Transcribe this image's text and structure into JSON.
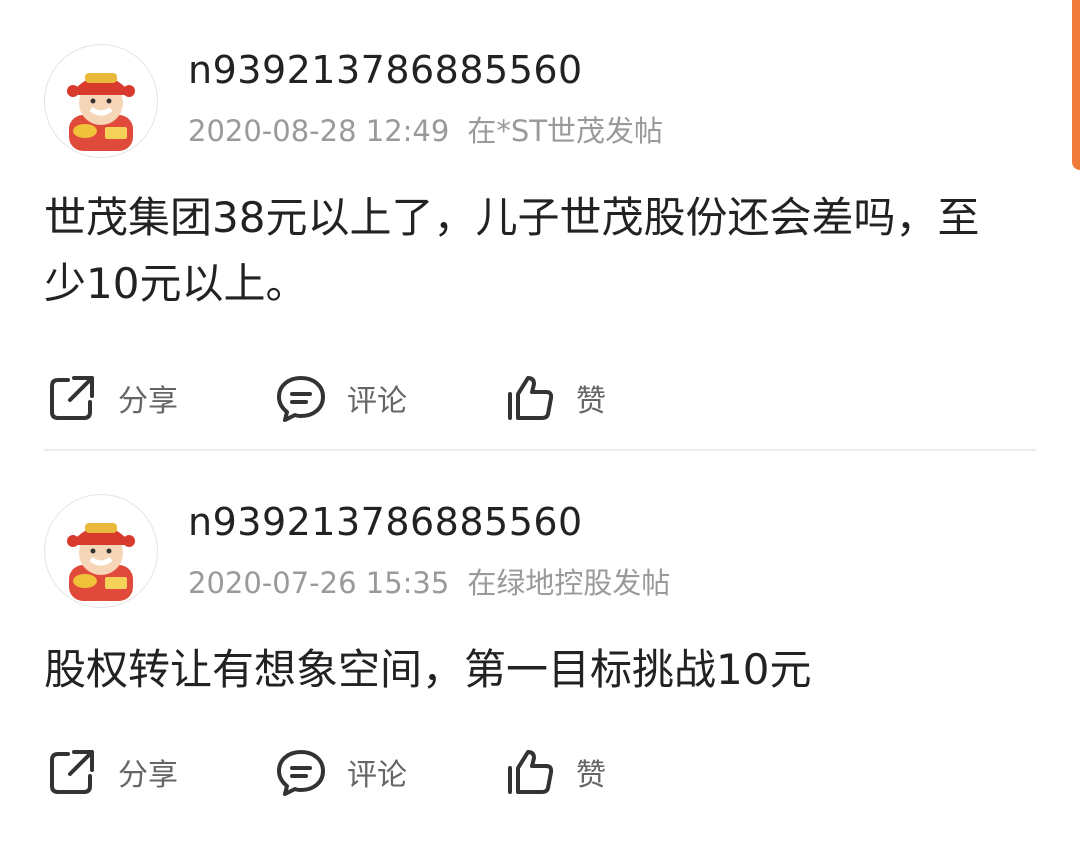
{
  "posts": [
    {
      "username": "n939213786885560",
      "timestamp": "2020-08-28 12:49",
      "location": "在*ST世茂发帖",
      "content": "世茂集团38元以上了，儿子世茂股份还会差吗，至少10元以上。",
      "actions": {
        "share": "分享",
        "comment": "评论",
        "like": "赞"
      }
    },
    {
      "username": "n939213786885560",
      "timestamp": "2020-07-26 15:35",
      "location": "在绿地控股发帖",
      "content": "股权转让有想象空间，第一目标挑战10元",
      "actions": {
        "share": "分享",
        "comment": "评论",
        "like": "赞"
      }
    }
  ],
  "icons": {
    "avatar": "cartoon-fortune-god-avatar",
    "share": "share-icon",
    "comment": "comment-icon",
    "like": "thumbs-up-icon"
  },
  "colors": {
    "accent": "#f07a3a",
    "meta": "#9a9a9a",
    "text": "#222222"
  }
}
